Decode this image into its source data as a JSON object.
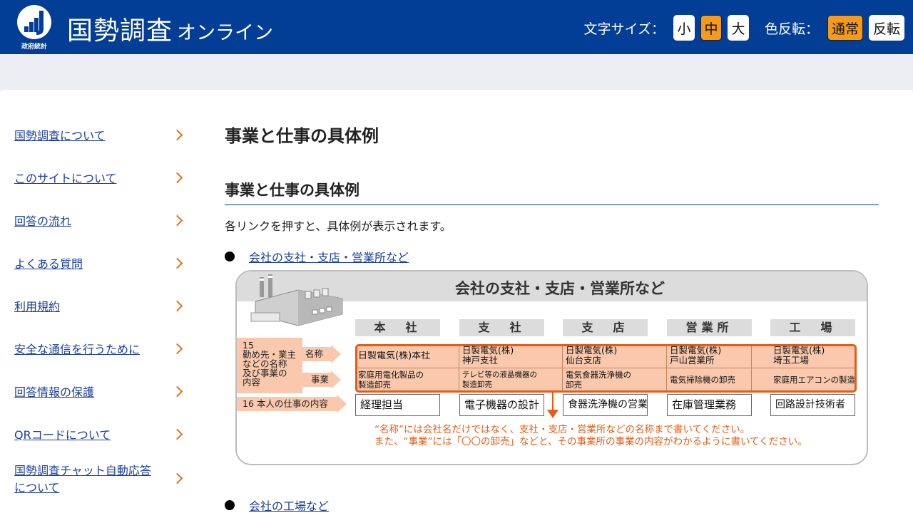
{
  "header": {
    "logo_caption": "政府統計",
    "title_main": "国勢調査",
    "title_sub": "オンライン",
    "font_size_label": "文字サイズ：",
    "font_sizes": [
      "小",
      "中",
      "大"
    ],
    "font_size_selected": "中",
    "color_label": "色反転：",
    "color_modes": [
      "通常",
      "反転"
    ],
    "color_mode_selected": "通常",
    "brand_color": "#033e96",
    "accent_color": "#f49a1c"
  },
  "sidebar": {
    "items": [
      {
        "label": "国勢調査について"
      },
      {
        "label": "このサイトについて"
      },
      {
        "label": "回答の流れ"
      },
      {
        "label": "よくある質問"
      },
      {
        "label": "利用規約"
      },
      {
        "label": "安全な通信を行うために"
      },
      {
        "label": "回答情報の保護"
      },
      {
        "label": "QRコードについて"
      },
      {
        "label": "国勢調査チャット自動応答について"
      }
    ]
  },
  "main": {
    "page_title": "事業と仕事の具体例",
    "section_title": "事業と仕事の具体例",
    "description": "各リンクを押すと、具体例が表示されます。",
    "links": [
      {
        "label": "会社の支社・支店・営業所など"
      },
      {
        "label": "会社の工場など"
      }
    ]
  },
  "diagram": {
    "title": "会社の支社・支店・営業所など",
    "columns": [
      "本　社",
      "支　社",
      "支　店",
      "営業所",
      "工　場"
    ],
    "left_label": "15\n勤め先・業主\nなどの名称\n及び事業の\n内容",
    "name_label": "名称",
    "business_label": "事業",
    "job_label": "16 本人の仕事の内容",
    "names": [
      "日製電気(株)本社",
      "日製電気(株)\n神戸支社",
      "日製電気(株)\n仙台支店",
      "日製電気(株)\n戸山営業所",
      "日製電気(株)\n埼玉工場"
    ],
    "businesses": [
      "家庭用電化製品の\n製造卸売",
      "テレビ等の液晶機器の\n製造卸売",
      "電気食器洗浄機の\n卸売",
      "電気掃除機の卸売",
      "家庭用エアコンの製造"
    ],
    "jobs": [
      "経理担当",
      "電子機器の設計",
      "食器洗浄機の営業",
      "在庫管理業務",
      "回路設計技術者"
    ],
    "notes": [
      "“名称”には会社名だけではなく、支社・支店・営業所などの名称まで書いてください。",
      "また、“事業”には「〇〇の卸売」などと、その事業所の事業の内容がわかるように書いてください。"
    ],
    "highlight_color": "#e65c17",
    "fill_color": "#fac9ad"
  }
}
